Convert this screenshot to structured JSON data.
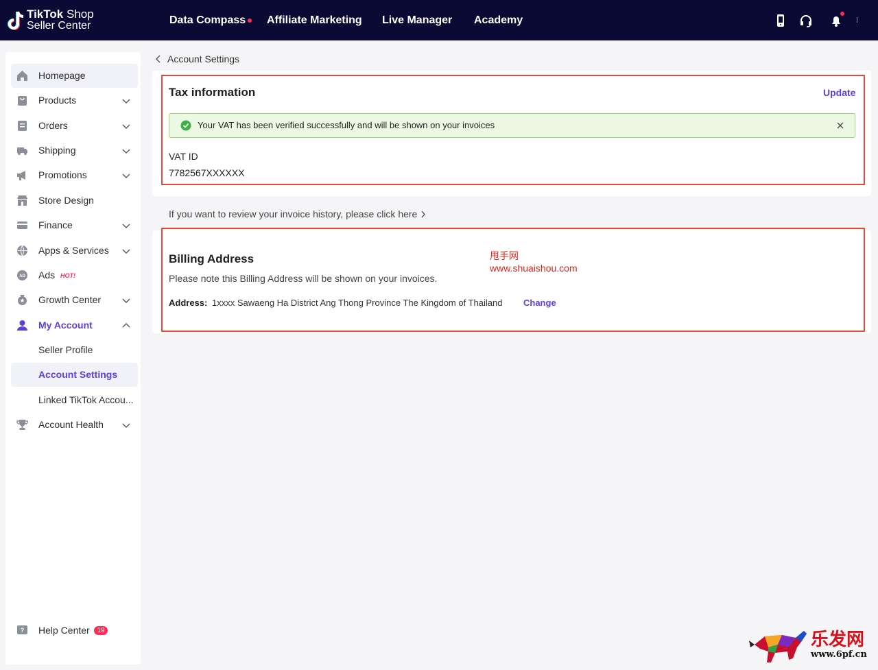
{
  "topbar": {
    "logo_line1_bold": "TikTok",
    "logo_line1_rest": "Shop",
    "logo_line2": "Seller Center",
    "nav": [
      {
        "label": "Data Compass"
      },
      {
        "label": "Affiliate Marketing"
      },
      {
        "label": "Live Manager"
      },
      {
        "label": "Academy"
      }
    ],
    "icons": [
      "phone-icon",
      "headset-icon",
      "bell-icon"
    ],
    "accent_color": "#fe2c55",
    "bg_color": "#0a0a35"
  },
  "sidebar": {
    "items": [
      {
        "label": "Homepage",
        "icon": "home-icon",
        "active": true
      },
      {
        "label": "Products",
        "icon": "bag-icon",
        "expandable": true
      },
      {
        "label": "Orders",
        "icon": "document-icon",
        "expandable": true
      },
      {
        "label": "Shipping",
        "icon": "truck-icon",
        "expandable": true
      },
      {
        "label": "Promotions",
        "icon": "megaphone-icon",
        "expandable": true
      },
      {
        "label": "Store Design",
        "icon": "store-icon"
      },
      {
        "label": "Finance",
        "icon": "card-icon",
        "expandable": true
      },
      {
        "label": "Apps & Services",
        "icon": "globe-icon",
        "expandable": true
      },
      {
        "label": "Ads",
        "icon": "ad-icon",
        "tag": "HOT!"
      },
      {
        "label": "Growth Center",
        "icon": "medal-icon",
        "expandable": true
      },
      {
        "label": "My Account",
        "icon": "user-icon",
        "expanded": true
      },
      {
        "label": "Seller Profile"
      },
      {
        "label": "Account Settings",
        "active": true
      },
      {
        "label": "Linked TikTok Accou..."
      },
      {
        "label": "Account Health",
        "icon": "trophy-icon",
        "expandable": true
      }
    ],
    "help": {
      "label": "Help Center",
      "icon": "help-icon",
      "badge": "19"
    }
  },
  "breadcrumb": {
    "label": "Account Settings"
  },
  "tax": {
    "title": "Tax information",
    "update_label": "Update",
    "alert_text": "Your VAT has been verified successfully and will be shown on your invoices",
    "vat_label": "VAT ID",
    "vat_value": "7782567XXXXXX"
  },
  "invoice_hint": "If you want to review your invoice history, please click here",
  "billing": {
    "title": "Billing Address",
    "note": "Please note this Billing Address will be shown on your invoices.",
    "address_label": "Address:",
    "address_value": "1xxxx Sawaeng Ha District Ang Thong Province The Kingdom of Thailand",
    "change_label": "Change"
  },
  "watermarks": {
    "site_cn": "甩手网",
    "site_url": "www.shuaishou.com",
    "corner_cn": "乐发网",
    "corner_url": "www.6pf.cn"
  },
  "colors": {
    "primary": "#5e3fd9",
    "success_bg": "#ecf8e3",
    "highlight_border": "#e24b36"
  }
}
